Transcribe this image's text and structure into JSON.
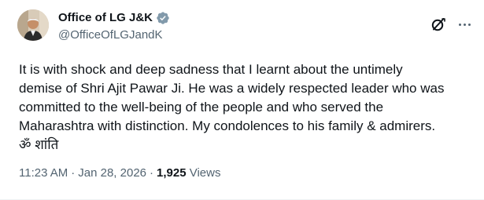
{
  "tweet": {
    "author": {
      "display_name": "Office of LG J&K",
      "handle": "@OfficeOfLGJandK",
      "verified": true,
      "avatar_icon": "profile-photo"
    },
    "header_actions": {
      "grok_icon": "grok-icon",
      "more_icon": "more-icon"
    },
    "text": "It is with shock and deep sadness that I learnt about the untimely\ndemise of Shri Ajit Pawar Ji. He was a widely respected leader who was\ncommitted to the well-being of the people and who served the\nMaharashtra with distinction. My condolences to his family & admirers.\nॐ शांति",
    "time": "11:23 AM",
    "separator": "·",
    "date": "Jan 28, 2026",
    "views_count": "1,925",
    "views_label": "Views"
  },
  "colors": {
    "text_primary": "#0f1419",
    "text_secondary": "#536471",
    "verified_badge": "#829aab"
  }
}
